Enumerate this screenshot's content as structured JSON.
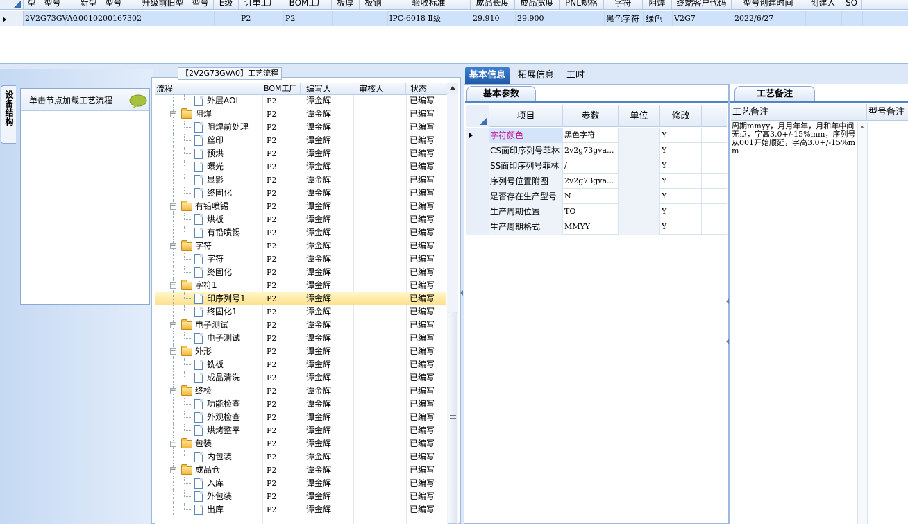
{
  "top_grid": {
    "headers": [
      "型　型号",
      "新型　型号",
      "升级前旧型　型号",
      "E级",
      "订单工厂",
      "BOM工厂",
      "板厚",
      "板铜",
      "验收标准",
      "成品长度",
      "成品宽度",
      "PNL规格",
      "字符",
      "阻焊",
      "终端客户代码",
      "型号创建时间",
      "创建人",
      "SO"
    ],
    "row": {
      "model": "2V2G73GVA0",
      "new_model": "10010200167302",
      "order_factory": "P2",
      "bom_factory": "P2",
      "standard": "IPC-6018 Ⅱ级",
      "length": "29.910",
      "width": "29.900",
      "char": "黑色字符",
      "solder": "绿色",
      "customer_code": "V2G7",
      "created": "2022/6/27"
    }
  },
  "left_panel": {
    "vertical_tab": "设备结构",
    "load_hint": "单击节点加载工艺流程"
  },
  "process": {
    "title": "【2V2G73GVA0】工艺流程",
    "columns": [
      "流程",
      "BOM工厂",
      "编写人",
      "审核人",
      "状态"
    ],
    "rows": [
      {
        "name": "外层AOI",
        "level": 2,
        "factory": "P2",
        "author": "谭金辉",
        "reviewer": "",
        "status": "已编写"
      },
      {
        "name": "阻焊",
        "level": 1,
        "factory": "P2",
        "author": "谭金辉",
        "reviewer": "",
        "status": "已编写"
      },
      {
        "name": "阻焊前处理",
        "level": 2,
        "factory": "P2",
        "author": "谭金辉",
        "reviewer": "",
        "status": "已编写"
      },
      {
        "name": "丝印",
        "level": 2,
        "factory": "P2",
        "author": "谭金辉",
        "reviewer": "",
        "status": "已编写"
      },
      {
        "name": "预烘",
        "level": 2,
        "factory": "P2",
        "author": "谭金辉",
        "reviewer": "",
        "status": "已编写"
      },
      {
        "name": "曝光",
        "level": 2,
        "factory": "P2",
        "author": "谭金辉",
        "reviewer": "",
        "status": "已编写"
      },
      {
        "name": "显影",
        "level": 2,
        "factory": "P2",
        "author": "谭金辉",
        "reviewer": "",
        "status": "已编写"
      },
      {
        "name": "终固化",
        "level": 2,
        "factory": "P2",
        "author": "谭金辉",
        "reviewer": "",
        "status": "已编写"
      },
      {
        "name": "有铅喷锡",
        "level": 1,
        "factory": "P2",
        "author": "谭金辉",
        "reviewer": "",
        "status": "已编写"
      },
      {
        "name": "烘板",
        "level": 2,
        "factory": "P2",
        "author": "谭金辉",
        "reviewer": "",
        "status": "已编写"
      },
      {
        "name": "有铅喷锡",
        "level": 2,
        "factory": "P2",
        "author": "谭金辉",
        "reviewer": "",
        "status": "已编写"
      },
      {
        "name": "字符",
        "level": 1,
        "factory": "P2",
        "author": "谭金辉",
        "reviewer": "",
        "status": "已编写"
      },
      {
        "name": "字符",
        "level": 2,
        "factory": "P2",
        "author": "谭金辉",
        "reviewer": "",
        "status": "已编写"
      },
      {
        "name": "终固化",
        "level": 2,
        "factory": "P2",
        "author": "谭金辉",
        "reviewer": "",
        "status": "已编写"
      },
      {
        "name": "字符1",
        "level": 1,
        "factory": "P2",
        "author": "谭金辉",
        "reviewer": "",
        "status": "已编写"
      },
      {
        "name": "印序列号1",
        "level": 2,
        "factory": "P2",
        "author": "谭金辉",
        "reviewer": "",
        "status": "已编写",
        "selected": true
      },
      {
        "name": "终固化1",
        "level": 2,
        "factory": "P2",
        "author": "谭金辉",
        "reviewer": "",
        "status": "已编写"
      },
      {
        "name": "电子测试",
        "level": 1,
        "factory": "P2",
        "author": "谭金辉",
        "reviewer": "",
        "status": "已编写"
      },
      {
        "name": "电子测试",
        "level": 2,
        "factory": "P2",
        "author": "谭金辉",
        "reviewer": "",
        "status": "已编写"
      },
      {
        "name": "外形",
        "level": 1,
        "factory": "P2",
        "author": "谭金辉",
        "reviewer": "",
        "status": "已编写"
      },
      {
        "name": "铣板",
        "level": 2,
        "factory": "P2",
        "author": "谭金辉",
        "reviewer": "",
        "status": "已编写"
      },
      {
        "name": "成品清洗",
        "level": 2,
        "factory": "P2",
        "author": "谭金辉",
        "reviewer": "",
        "status": "已编写"
      },
      {
        "name": "终检",
        "level": 1,
        "factory": "P2",
        "author": "谭金辉",
        "reviewer": "",
        "status": "已编写"
      },
      {
        "name": "功能检查",
        "level": 2,
        "factory": "P2",
        "author": "谭金辉",
        "reviewer": "",
        "status": "已编写"
      },
      {
        "name": "外观检查",
        "level": 2,
        "factory": "P2",
        "author": "谭金辉",
        "reviewer": "",
        "status": "已编写"
      },
      {
        "name": "烘烤整平",
        "level": 2,
        "factory": "P2",
        "author": "谭金辉",
        "reviewer": "",
        "status": "已编写"
      },
      {
        "name": "包装",
        "level": 1,
        "factory": "P2",
        "author": "谭金辉",
        "reviewer": "",
        "status": "已编写"
      },
      {
        "name": "内包装",
        "level": 2,
        "factory": "P2",
        "author": "谭金辉",
        "reviewer": "",
        "status": "已编写"
      },
      {
        "name": "成品仓",
        "level": 1,
        "factory": "P2",
        "author": "谭金辉",
        "reviewer": "",
        "status": "已编写"
      },
      {
        "name": "入库",
        "level": 2,
        "factory": "P2",
        "author": "谭金辉",
        "reviewer": "",
        "status": "已编写"
      },
      {
        "name": "外包装",
        "level": 2,
        "factory": "P2",
        "author": "谭金辉",
        "reviewer": "",
        "status": "已编写"
      },
      {
        "name": "出库",
        "level": 2,
        "factory": "P2",
        "author": "谭金辉",
        "reviewer": "",
        "status": "已编写"
      }
    ]
  },
  "mid_tabs": [
    "基本信息",
    "拓展信息",
    "工时"
  ],
  "basic_params": {
    "subtab": "基本参数",
    "columns": [
      "项目",
      "参数",
      "单位",
      "修改"
    ],
    "rows": [
      {
        "item": "字符颜色",
        "param": "黑色字符",
        "unit": "",
        "modify": "Y"
      },
      {
        "item": "CS面印序列号菲林",
        "param": "2v2g73gva...",
        "unit": "",
        "modify": "Y"
      },
      {
        "item": "SS面印序列号菲林",
        "param": "/",
        "unit": "",
        "modify": "Y"
      },
      {
        "item": "序列号位置附图",
        "param": "2v2g73gva...",
        "unit": "",
        "modify": "Y"
      },
      {
        "item": "是否存在生产型号",
        "param": "N",
        "unit": "",
        "modify": "Y"
      },
      {
        "item": "生产周期位置",
        "param": "TO",
        "unit": "",
        "modify": "Y"
      },
      {
        "item": "生产周期格式",
        "param": "MMYY",
        "unit": "",
        "modify": "Y"
      }
    ]
  },
  "remarks": {
    "tab": "工艺备注",
    "columns": [
      "工艺备注",
      "型号备注"
    ],
    "note": "周期mmyy，月月年年，月和年中间无点，字高3.0+/-15%mm，序列号从001开始顺延，字高3.0+/-15%mm"
  },
  "colors": {
    "accent": "#1e5aa8",
    "selection": "#fde089",
    "grid_row": "#cfe2fb"
  }
}
